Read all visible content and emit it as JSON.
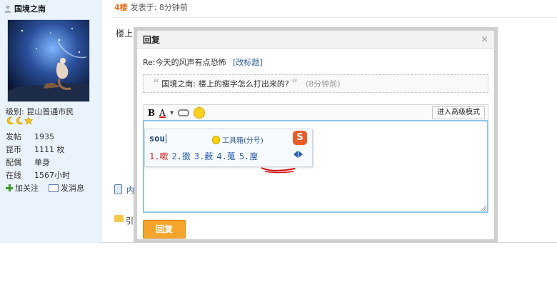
{
  "profile": {
    "username": "国境之南",
    "level_label": "级别:",
    "level_value": "昆山普通市民",
    "stats": [
      {
        "key": "发帖",
        "value": "1935"
      },
      {
        "key": "昆币",
        "value": "1111 枚"
      },
      {
        "key": "配偶",
        "value": "单身"
      },
      {
        "key": "在线",
        "value": "1567小时"
      }
    ],
    "follow_label": "加关注",
    "message_label": "发消息"
  },
  "post": {
    "floor": "4楼",
    "meta": "发表于: 8分钟前",
    "text": "楼上",
    "side_phone_text": "内",
    "side_quote_text": "引"
  },
  "dialog": {
    "title": "回复",
    "close": "×",
    "re_title": "Re:今天的风声有点恐怖",
    "re_edit_link": "[改标题]",
    "quote_author": "国境之南:",
    "quote_text": "楼上的瘦字怎么打出来的?",
    "quote_open": "“",
    "quote_close": "”",
    "quote_time": "(8分钟前)",
    "toolbar": {
      "bold": "B",
      "color": "A",
      "advanced_mode": "进入高级模式"
    },
    "ime": {
      "input": "sou",
      "toolbox": "工具箱(分号)",
      "logo": "S",
      "candidates": [
        "1.嗽",
        "2.擞",
        "3.薮",
        "4.蒐",
        "5.廋"
      ]
    },
    "reply_button": "回复"
  },
  "colors": {
    "accent_orange": "#f5a52b",
    "floor_orange": "#f26c1a",
    "link_blue": "#2a5a9a",
    "editor_border": "#8ec6e8",
    "sidebar_bg": "#eaf2fb"
  }
}
